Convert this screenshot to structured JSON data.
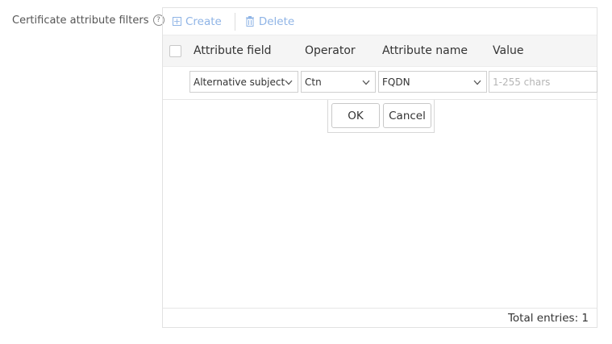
{
  "field": {
    "label": "Certificate attribute filters",
    "help_icon": "?"
  },
  "toolbar": {
    "create_label": "Create",
    "delete_label": "Delete"
  },
  "table": {
    "columns": [
      "Attribute field",
      "Operator",
      "Attribute name",
      "Value"
    ]
  },
  "edit_row": {
    "attribute_field": "Alternative subject",
    "operator": "Ctn",
    "attribute_name": "FQDN",
    "value_placeholder": "1-255 chars"
  },
  "popover": {
    "ok_label": "OK",
    "cancel_label": "Cancel"
  },
  "footer": {
    "total_label": "Total entries: 1"
  },
  "colors": {
    "toolbar_link": "#8fb4e6",
    "header_bg": "#f5f5f5",
    "border": "#e2e2e2"
  }
}
